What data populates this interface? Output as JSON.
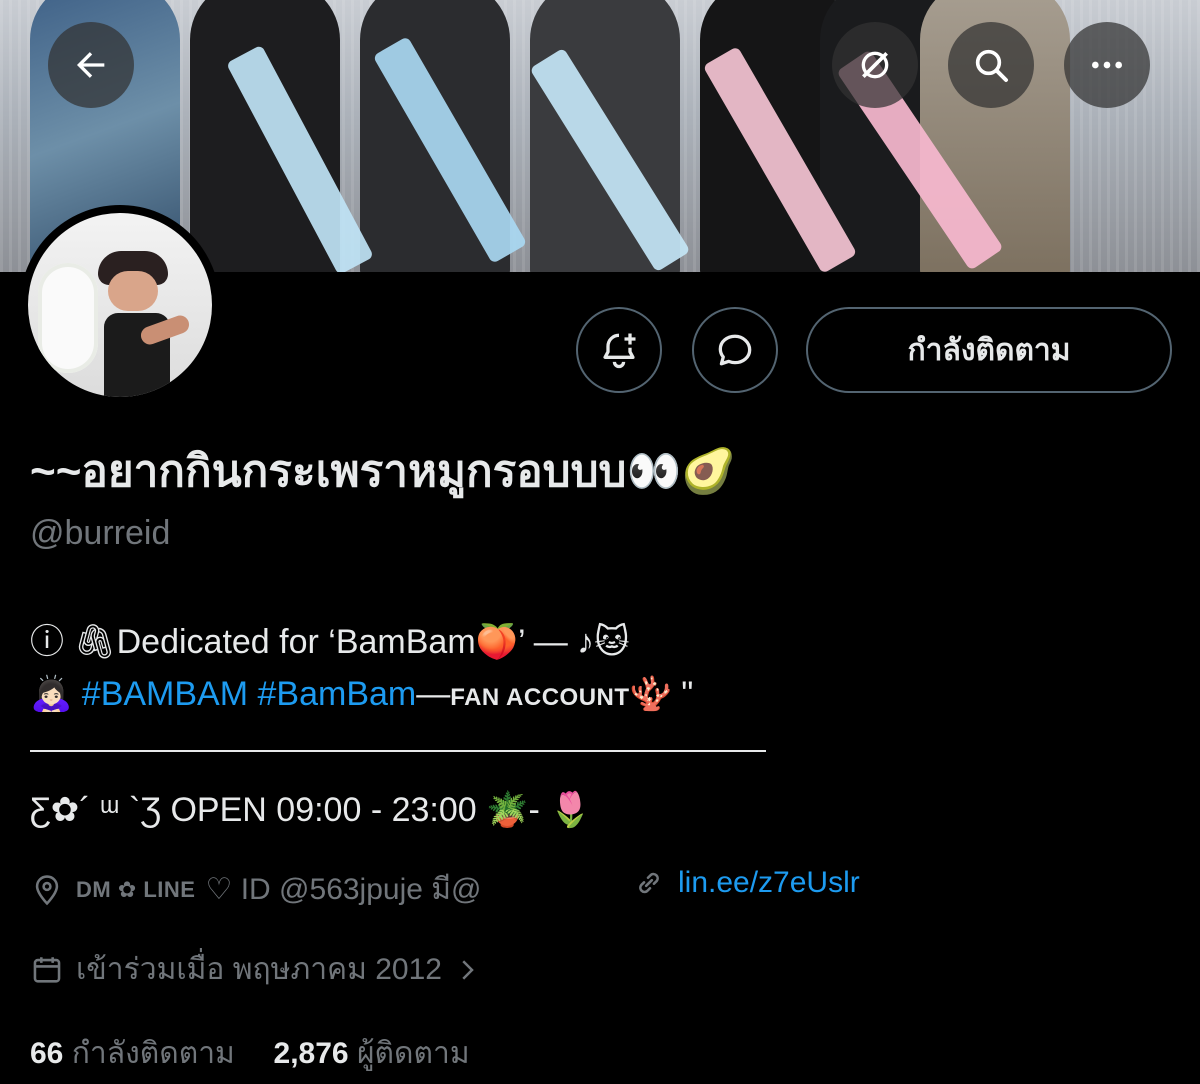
{
  "header": {
    "back_icon": "arrow-left-icon",
    "grok_icon": "slash-circle-icon",
    "search_icon": "search-icon",
    "more_icon": "more-horizontal-icon"
  },
  "profile": {
    "notify_icon": "bell-plus-icon",
    "message_icon": "chat-bubble-icon",
    "follow_label": "กำลังติดตาม",
    "display_name": "~~อยากกินกระเพราหมูกรอบบบ👀🥑",
    "handle": "@burreid",
    "bio": {
      "line1": "ⓘ 🖇Dedicated for ‘BamBam🍑’ — ♪🐱",
      "line2_emoji": "🙇🏻‍♀️",
      "hashtag1": "#BAMBAM",
      "hashtag2": "#BamBam",
      "line2_rest": "—",
      "line2_caps": "FAN ACCOUNT",
      "line2_tail": "🪸 \"",
      "line3": "Ƹ✿´ ᵚ `Ʒ OPEN 09:00 - 23:00 🪴- 🌷"
    },
    "location_prefix": "DM ✿ LINE",
    "location": "♡ ID @563jpuje มี@",
    "link": "lin.ee/z7eUslr",
    "joined": "เข้าร่วมเมื่อ พฤษภาคม 2012"
  },
  "stats": {
    "following_count": "66",
    "following_label": "กำลังติดตาม",
    "followers_count": "2,876",
    "followers_label": "ผู้ติดตาม"
  },
  "colors": {
    "accent": "#1d9bf0",
    "muted": "#71767b",
    "text": "#e7e9ea",
    "border": "#536471"
  }
}
